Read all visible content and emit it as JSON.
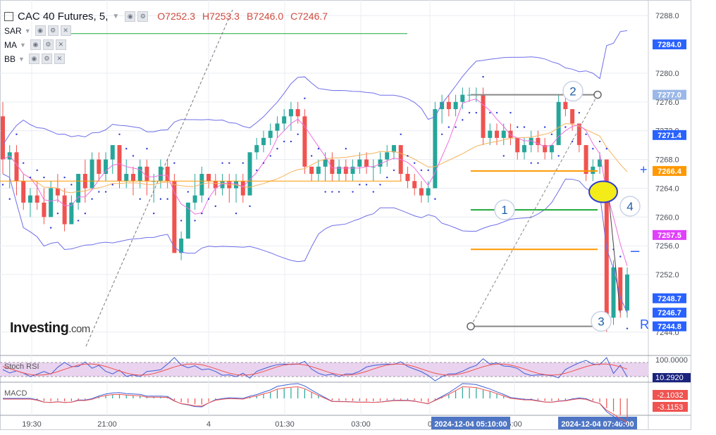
{
  "header": {
    "symbol": "CAC 40 Futures, 5,",
    "open": "O7252.3",
    "high": "H7253.3",
    "low": "B7246.0",
    "close": "C7246.7"
  },
  "indicators": [
    {
      "label": "SAR"
    },
    {
      "label": "MA"
    },
    {
      "label": "BB"
    }
  ],
  "logo": {
    "brand": "Investing",
    "suffix": ".com"
  },
  "sub_panels": {
    "stoch_rsi": "Stoch RSI",
    "macd": "MACD"
  },
  "colors": {
    "up": "#26a69a",
    "down": "#ef5350",
    "bb": "#6f6fe8",
    "sar": "#2d3bd6",
    "ma_fast": "#f06ee0",
    "ma_slow": "#f5b25c",
    "orange": "#ff9800",
    "green": "#1faa3a",
    "grid": "#e9ecf1"
  },
  "chart_data": {
    "type": "candlestick",
    "y_ticks": [
      "7288.0",
      "7280.0",
      "7276.0",
      "7272.0",
      "7268.0",
      "7264.0",
      "7260.0",
      "7256.0",
      "7252.0",
      "7244.0"
    ],
    "ylim": [
      7243,
      7289
    ],
    "x_ticks": [
      "19:30",
      "21:00",
      "4",
      "01:30",
      "03:00",
      "0",
      "6:00"
    ],
    "price_labels": [
      {
        "text": "7284.0",
        "value": 7284.0,
        "bg": "#2962ff"
      },
      {
        "text": "7277.0",
        "value": 7277.0,
        "bg": "#9bb8e8"
      },
      {
        "text": "7271.4",
        "value": 7271.4,
        "bg": "#2962ff"
      },
      {
        "text": "7266.4",
        "value": 7266.4,
        "bg": "#ff9800"
      },
      {
        "text": "7257.5",
        "value": 7257.5,
        "bg": "#e040fb"
      },
      {
        "text": "7248.7",
        "value": 7248.7,
        "bg": "#2962ff"
      },
      {
        "text": "7246.7",
        "value": 7246.7,
        "bg": "#2962ff"
      },
      {
        "text": "7244.8",
        "value": 7244.8,
        "bg": "#2962ff"
      }
    ],
    "time_labels": [
      "2024-12-04 05:10:00",
      "2024-12-04 07:40:00"
    ],
    "annotations": [
      {
        "text": "1",
        "value": 7261.0
      },
      {
        "text": "2",
        "value": 7277.5
      },
      {
        "text": "3",
        "value": 7245.5
      },
      {
        "text": "4",
        "value": 7261.5
      }
    ],
    "stoch_rsi": {
      "ticks": [
        "100.0000",
        "10.2920"
      ]
    },
    "macd": {
      "labels": [
        {
          "text": "-2.1032",
          "bg": "#ef5350"
        },
        {
          "text": "-3.1153",
          "bg": "#ef5350"
        }
      ]
    },
    "candles": [
      [
        7274,
        7276,
        7266,
        7268
      ],
      [
        7268,
        7270,
        7264,
        7269
      ],
      [
        7269,
        7270,
        7263,
        7265
      ],
      [
        7265,
        7266,
        7261,
        7262
      ],
      [
        7262,
        7264,
        7260,
        7263
      ],
      [
        7263,
        7265,
        7261,
        7262
      ],
      [
        7262,
        7264,
        7259,
        7260
      ],
      [
        7260,
        7265,
        7260,
        7264
      ],
      [
        7264,
        7266,
        7262,
        7263
      ],
      [
        7263,
        7264,
        7258,
        7259
      ],
      [
        7259,
        7263,
        7259,
        7262
      ],
      [
        7262,
        7266,
        7261,
        7266
      ],
      [
        7266,
        7268,
        7262,
        7264
      ],
      [
        7264,
        7269,
        7264,
        7268
      ],
      [
        7268,
        7269,
        7265,
        7266
      ],
      [
        7266,
        7269,
        7265,
        7268
      ],
      [
        7268,
        7270,
        7266,
        7270
      ],
      [
        7270,
        7270,
        7264,
        7265
      ],
      [
        7265,
        7268,
        7264,
        7266
      ],
      [
        7266,
        7267,
        7263,
        7265
      ],
      [
        7265,
        7268,
        7264,
        7267
      ],
      [
        7267,
        7268,
        7263,
        7265
      ],
      [
        7265,
        7266,
        7262,
        7265
      ],
      [
        7265,
        7268,
        7264,
        7267
      ],
      [
        7267,
        7268,
        7264,
        7265
      ],
      [
        7265,
        7266,
        7257,
        7255
      ],
      [
        7255,
        7258,
        7254,
        7257
      ],
      [
        7257,
        7262,
        7257,
        7262
      ],
      [
        7262,
        7266,
        7261,
        7263
      ],
      [
        7263,
        7267,
        7262,
        7266
      ],
      [
        7266,
        7266,
        7264,
        7265
      ],
      [
        7265,
        7266,
        7263,
        7264
      ],
      [
        7264,
        7266,
        7263,
        7265
      ],
      [
        7265,
        7266,
        7262,
        7264
      ],
      [
        7264,
        7266,
        7262,
        7265
      ],
      [
        7265,
        7266,
        7262,
        7263
      ],
      [
        7263,
        7269,
        7263,
        7269
      ],
      [
        7269,
        7271,
        7268,
        7270
      ],
      [
        7270,
        7272,
        7269,
        7271
      ],
      [
        7271,
        7273,
        7270,
        7272
      ],
      [
        7272,
        7274,
        7271,
        7273
      ],
      [
        7273,
        7275,
        7272,
        7274
      ],
      [
        7274,
        7276,
        7272,
        7275
      ],
      [
        7275,
        7276,
        7273,
        7274
      ],
      [
        7274,
        7275,
        7266,
        7267
      ],
      [
        7267,
        7267,
        7265,
        7266
      ],
      [
        7266,
        7268,
        7265,
        7267
      ],
      [
        7267,
        7269,
        7265,
        7268
      ],
      [
        7268,
        7269,
        7265,
        7266
      ],
      [
        7266,
        7268,
        7265,
        7267
      ],
      [
        7267,
        7268,
        7265,
        7266
      ],
      [
        7266,
        7268,
        7265,
        7267
      ],
      [
        7267,
        7269,
        7266,
        7268
      ],
      [
        7268,
        7269,
        7266,
        7267
      ],
      [
        7267,
        7268,
        7265,
        7267
      ],
      [
        7267,
        7269,
        7266,
        7268
      ],
      [
        7268,
        7270,
        7267,
        7269
      ],
      [
        7269,
        7270,
        7268,
        7270
      ],
      [
        7270,
        7270,
        7265,
        7266
      ],
      [
        7266,
        7267,
        7264,
        7265
      ],
      [
        7265,
        7266,
        7263,
        7264
      ],
      [
        7264,
        7265,
        7262,
        7263
      ],
      [
        7263,
        7265,
        7262,
        7264
      ],
      [
        7264,
        7276,
        7264,
        7275
      ],
      [
        7275,
        7277,
        7273,
        7276
      ],
      [
        7276,
        7277,
        7274,
        7275
      ],
      [
        7275,
        7277,
        7274,
        7276
      ],
      [
        7276,
        7278,
        7275,
        7277
      ],
      [
        7277,
        7278,
        7276,
        7277
      ],
      [
        7277,
        7278,
        7276,
        7277
      ],
      [
        7277,
        7278,
        7270,
        7271
      ],
      [
        7271,
        7273,
        7270,
        7272
      ],
      [
        7272,
        7273,
        7270,
        7271
      ],
      [
        7271,
        7273,
        7270,
        7272
      ],
      [
        7272,
        7273,
        7270,
        7271
      ],
      [
        7271,
        7271,
        7268,
        7269
      ],
      [
        7269,
        7271,
        7268,
        7270
      ],
      [
        7270,
        7272,
        7269,
        7271
      ],
      [
        7271,
        7272,
        7269,
        7270
      ],
      [
        7270,
        7271,
        7268,
        7269
      ],
      [
        7269,
        7270,
        7268,
        7270
      ],
      [
        7270,
        7277,
        7270,
        7276
      ],
      [
        7276,
        7277,
        7274,
        7275
      ],
      [
        7275,
        7275,
        7272,
        7273
      ],
      [
        7273,
        7273,
        7269,
        7270
      ],
      [
        7270,
        7270,
        7265,
        7266
      ],
      [
        7266,
        7268,
        7265,
        7267
      ],
      [
        7267,
        7269,
        7266,
        7268
      ],
      [
        7268,
        7268,
        7244,
        7246
      ],
      [
        7246,
        7254,
        7245,
        7253
      ],
      [
        7253,
        7253,
        7246,
        7247
      ],
      [
        7247,
        7253,
        7246,
        7252
      ]
    ]
  }
}
